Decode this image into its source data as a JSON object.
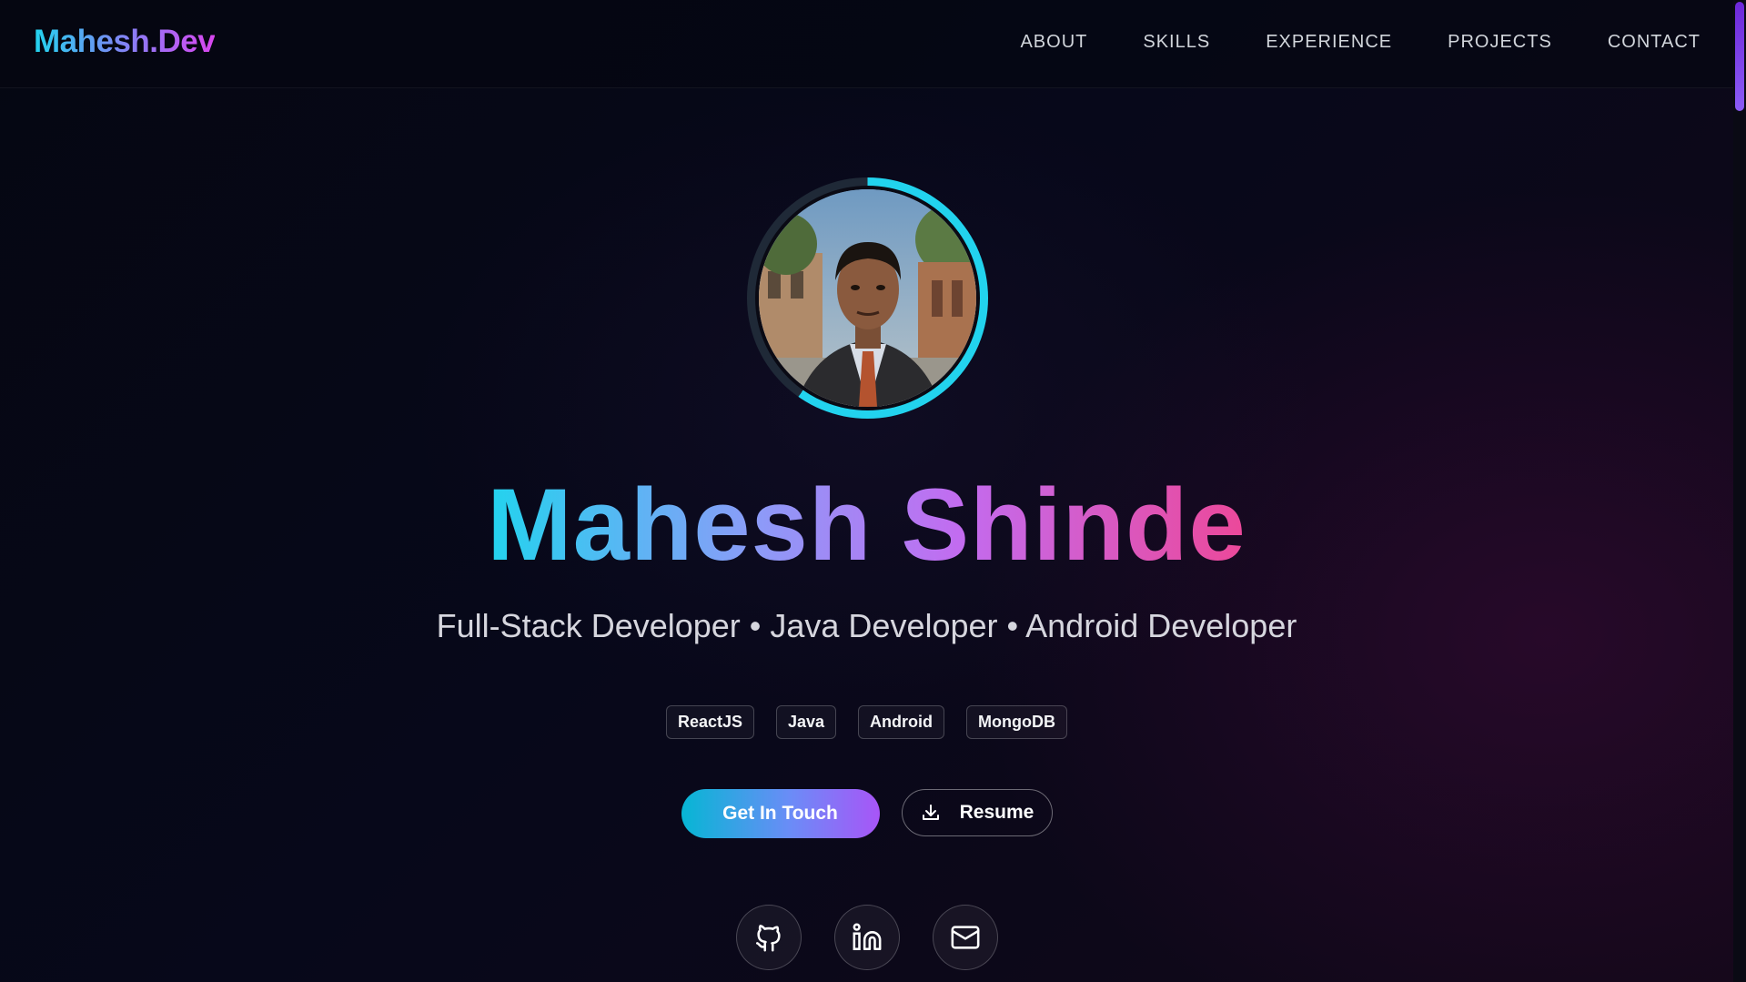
{
  "header": {
    "logo": "Mahesh.Dev",
    "nav": [
      {
        "label": "ABOUT"
      },
      {
        "label": "SKILLS"
      },
      {
        "label": "EXPERIENCE"
      },
      {
        "label": "PROJECTS"
      },
      {
        "label": "CONTACT"
      }
    ]
  },
  "hero": {
    "avatar_alt": "profile-photo",
    "name": "Mahesh Shinde",
    "tagline": "Full-Stack Developer • Java Developer • Android Developer",
    "tags": [
      "ReactJS",
      "Java",
      "Android",
      "MongoDB"
    ],
    "primary_button": "Get In Touch",
    "secondary_button": "Resume",
    "social": [
      {
        "icon": "github-icon"
      },
      {
        "icon": "linkedin-icon"
      },
      {
        "icon": "mail-icon"
      }
    ]
  },
  "colors": {
    "accent_cyan": "#22d3ee",
    "accent_violet": "#a855f7",
    "accent_pink": "#ec4899",
    "background": "#06060f"
  }
}
